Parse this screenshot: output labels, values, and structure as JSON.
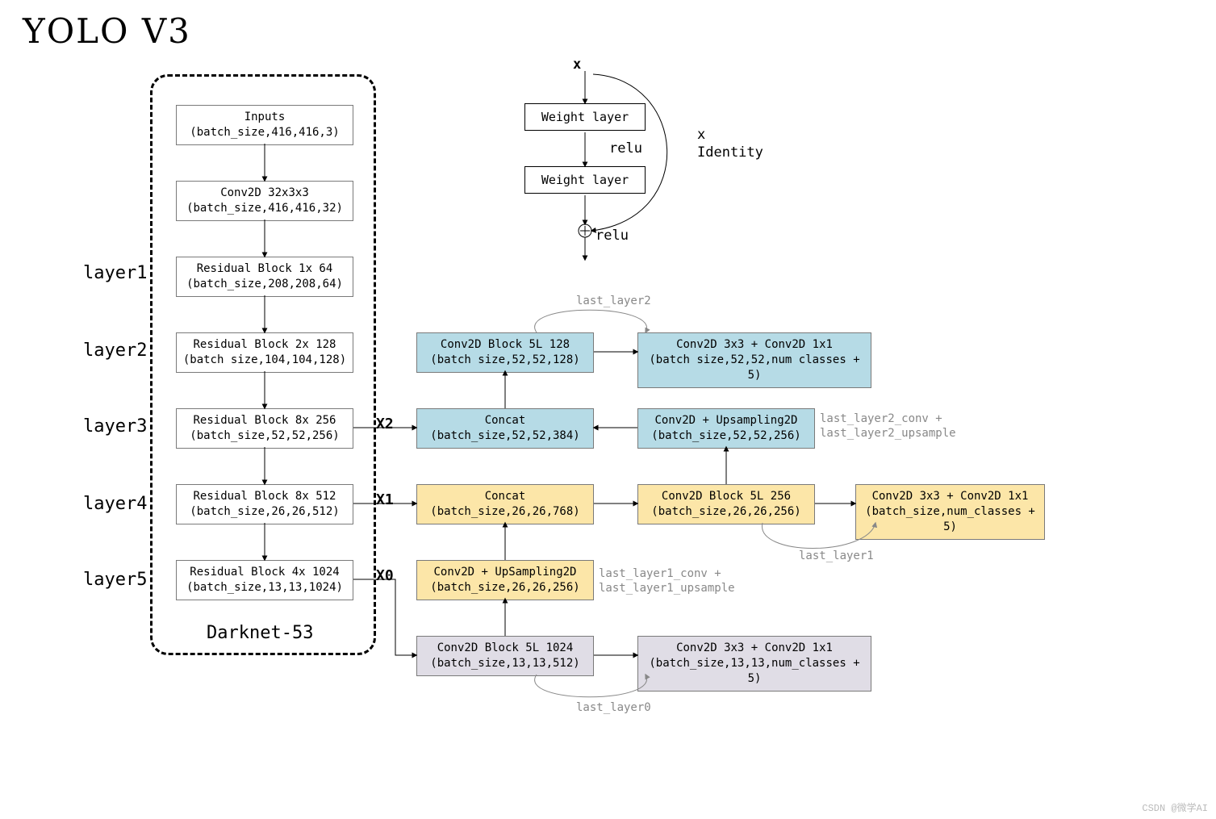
{
  "title": "YOLO V3",
  "darknet_label": "Darknet-53",
  "layer_labels": [
    "layer1",
    "layer2",
    "layer3",
    "layer4",
    "layer5"
  ],
  "backbone": {
    "inputs": {
      "t": "Inputs",
      "s": "(batch_size,416,416,3)"
    },
    "conv0": {
      "t": "Conv2D 32x3x3",
      "s": "(batch_size,416,416,32)"
    },
    "res1": {
      "t": "Residual Block 1x 64",
      "s": "(batch_size,208,208,64)"
    },
    "res2": {
      "t": "Residual Block 2x 128",
      "s": "(batch size,104,104,128)"
    },
    "res3": {
      "t": "Residual Block 8x 256",
      "s": "(batch_size,52,52,256)"
    },
    "res4": {
      "t": "Residual Block 8x 512",
      "s": "(batch_size,26,26,512)"
    },
    "res5": {
      "t": "Residual Block 4x 1024",
      "s": "(batch_size,13,13,1024)"
    }
  },
  "heads": {
    "c5_128": {
      "t": "Conv2D Block 5L 128",
      "s": "(batch size,52,52,128)"
    },
    "out52": {
      "t": "Conv2D 3x3 + Conv2D 1x1",
      "s": "(batch size,52,52,num classes + 5)"
    },
    "cat52": {
      "t": "Concat",
      "s": "(batch_size,52,52,384)"
    },
    "up52": {
      "t": "Conv2D + Upsampling2D",
      "s": "(batch_size,52,52,256)"
    },
    "cat26": {
      "t": "Concat",
      "s": "(batch_size,26,26,768)"
    },
    "c5_256": {
      "t": "Conv2D Block 5L 256",
      "s": "(batch_size,26,26,256)"
    },
    "out26": {
      "t": "Conv2D 3x3 + Conv2D 1x1",
      "s": "(batch_size,num_classes + 5)"
    },
    "up26": {
      "t": "Conv2D + UpSampling2D",
      "s": "(batch_size,26,26,256)"
    },
    "c5_1024": {
      "t": "Conv2D Block 5L 1024",
      "s": "(batch_size,13,13,512)"
    },
    "out13": {
      "t": "Conv2D 3x3 + Conv2D 1x1",
      "s": "(batch_size,13,13,num_classes + 5)"
    }
  },
  "tags": {
    "x0": "X0",
    "x1": "X1",
    "x2": "X2"
  },
  "annots": {
    "ll2": "last_layer2",
    "ll2cu": "last_layer2_conv +\nlast_layer2_upsample",
    "ll1": "last_layer1",
    "ll1cu": "last_layer1_conv +\nlast_layer1_upsample",
    "ll0": "last_layer0"
  },
  "residual": {
    "x": "x",
    "wl": "Weight layer",
    "relu": "relu",
    "xid": "x\nIdentity"
  },
  "watermark": "CSDN @微学AI"
}
